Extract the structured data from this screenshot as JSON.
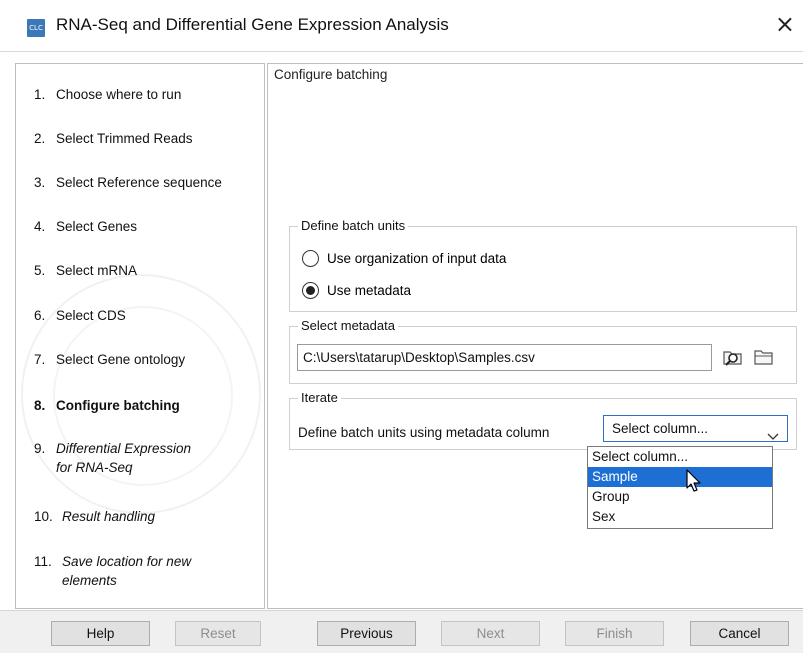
{
  "window": {
    "app_icon_text": "CLC",
    "title": "RNA-Seq and Differential Gene Expression Analysis",
    "close_glyph": "×"
  },
  "steps": [
    {
      "num": "1.",
      "label": "Choose where to run",
      "state": "done"
    },
    {
      "num": "2.",
      "label": "Select Trimmed Reads",
      "state": "done"
    },
    {
      "num": "3.",
      "label": "Select Reference sequence",
      "state": "done"
    },
    {
      "num": "4.",
      "label": "Select Genes",
      "state": "done"
    },
    {
      "num": "5.",
      "label": "Select mRNA",
      "state": "done"
    },
    {
      "num": "6.",
      "label": "Select CDS",
      "state": "done"
    },
    {
      "num": "7.",
      "label": "Select Gene ontology",
      "state": "done"
    },
    {
      "num": "8.",
      "label": "Configure batching",
      "state": "active"
    },
    {
      "num": "9.",
      "label_line1": "Differential Expression",
      "label_line2": "for RNA-Seq",
      "state": "future"
    },
    {
      "num": "10.",
      "label": "Result handling",
      "state": "future"
    },
    {
      "num": "11.",
      "label_line1": "Save location for new",
      "label_line2": "elements",
      "state": "future"
    }
  ],
  "main": {
    "section_title": "Configure batching",
    "batch_units": {
      "legend": "Define batch units",
      "options": [
        {
          "label": "Use organization of input data",
          "selected": false
        },
        {
          "label": "Use metadata",
          "selected": true
        }
      ]
    },
    "metadata": {
      "legend": "Select metadata",
      "path_value": "C:\\Users\\tatarup\\Desktop\\Samples.csv",
      "browse_icon": "browse-search-icon",
      "folder_icon": "folder-icon"
    },
    "iterate": {
      "legend": "Iterate",
      "label": "Define batch units using metadata column",
      "select_value": "Select column...",
      "options": [
        "Select column...",
        "Sample",
        "Group",
        "Sex"
      ],
      "highlighted_option": "Sample"
    }
  },
  "buttons": {
    "help": "Help",
    "reset": "Reset",
    "previous": "Previous",
    "next": "Next",
    "finish": "Finish",
    "cancel": "Cancel"
  },
  "colors": {
    "accent": "#1e6fd4",
    "app_icon": "#3a78b8"
  }
}
